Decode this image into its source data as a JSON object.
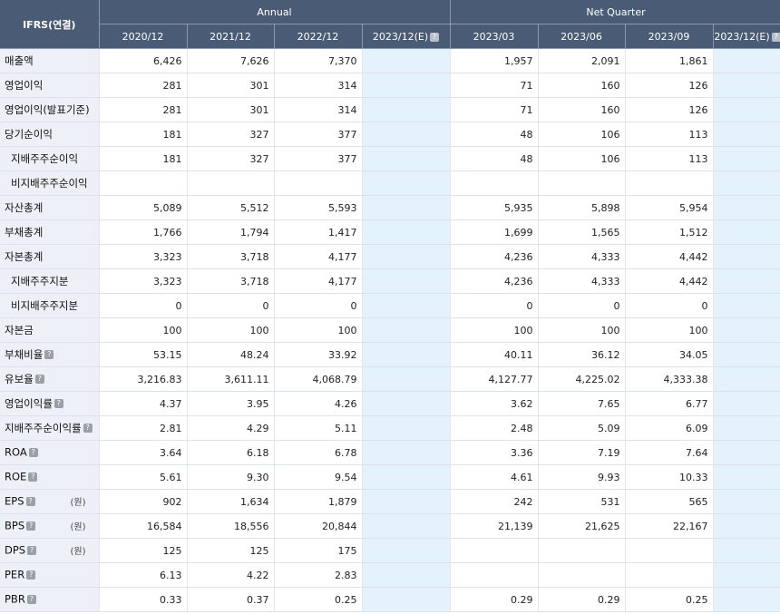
{
  "header": {
    "corner": "IFRS(연결)",
    "annual_label": "Annual",
    "quarter_label": "Net Quarter",
    "annual_periods": [
      "2020/12",
      "2021/12",
      "2022/12",
      "2023/12(E)"
    ],
    "quarter_periods": [
      "2023/03",
      "2023/06",
      "2023/09",
      "2023/12(E)"
    ],
    "help_icon": "question-mark-icon"
  },
  "rows": [
    {
      "label": "매출액",
      "indent": false,
      "help": false,
      "unit": "",
      "annual": [
        "6,426",
        "7,626",
        "7,370",
        ""
      ],
      "quarter": [
        "1,957",
        "2,091",
        "1,861",
        ""
      ]
    },
    {
      "label": "영업이익",
      "indent": false,
      "help": false,
      "unit": "",
      "annual": [
        "281",
        "301",
        "314",
        ""
      ],
      "quarter": [
        "71",
        "160",
        "126",
        ""
      ]
    },
    {
      "label": "영업이익(발표기준)",
      "indent": false,
      "help": false,
      "unit": "",
      "annual": [
        "281",
        "301",
        "314",
        ""
      ],
      "quarter": [
        "71",
        "160",
        "126",
        ""
      ]
    },
    {
      "label": "당기순이익",
      "indent": false,
      "help": false,
      "unit": "",
      "annual": [
        "181",
        "327",
        "377",
        ""
      ],
      "quarter": [
        "48",
        "106",
        "113",
        ""
      ]
    },
    {
      "label": "지배주주순이익",
      "indent": true,
      "help": false,
      "unit": "",
      "annual": [
        "181",
        "327",
        "377",
        ""
      ],
      "quarter": [
        "48",
        "106",
        "113",
        ""
      ]
    },
    {
      "label": "비지배주주순이익",
      "indent": true,
      "help": false,
      "unit": "",
      "annual": [
        "",
        "",
        "",
        ""
      ],
      "quarter": [
        "",
        "",
        "",
        ""
      ]
    },
    {
      "label": "자산총계",
      "indent": false,
      "help": false,
      "unit": "",
      "annual": [
        "5,089",
        "5,512",
        "5,593",
        ""
      ],
      "quarter": [
        "5,935",
        "5,898",
        "5,954",
        ""
      ]
    },
    {
      "label": "부채총계",
      "indent": false,
      "help": false,
      "unit": "",
      "annual": [
        "1,766",
        "1,794",
        "1,417",
        ""
      ],
      "quarter": [
        "1,699",
        "1,565",
        "1,512",
        ""
      ]
    },
    {
      "label": "자본총계",
      "indent": false,
      "help": false,
      "unit": "",
      "annual": [
        "3,323",
        "3,718",
        "4,177",
        ""
      ],
      "quarter": [
        "4,236",
        "4,333",
        "4,442",
        ""
      ]
    },
    {
      "label": "지배주주지분",
      "indent": true,
      "help": false,
      "unit": "",
      "annual": [
        "3,323",
        "3,718",
        "4,177",
        ""
      ],
      "quarter": [
        "4,236",
        "4,333",
        "4,442",
        ""
      ]
    },
    {
      "label": "비지배주주지분",
      "indent": true,
      "help": false,
      "unit": "",
      "annual": [
        "0",
        "0",
        "0",
        ""
      ],
      "quarter": [
        "0",
        "0",
        "0",
        ""
      ]
    },
    {
      "label": "자본금",
      "indent": false,
      "help": false,
      "unit": "",
      "annual": [
        "100",
        "100",
        "100",
        ""
      ],
      "quarter": [
        "100",
        "100",
        "100",
        ""
      ]
    },
    {
      "label": "부채비율",
      "indent": false,
      "help": true,
      "unit": "",
      "annual": [
        "53.15",
        "48.24",
        "33.92",
        ""
      ],
      "quarter": [
        "40.11",
        "36.12",
        "34.05",
        ""
      ]
    },
    {
      "label": "유보율",
      "indent": false,
      "help": true,
      "unit": "",
      "annual": [
        "3,216.83",
        "3,611.11",
        "4,068.79",
        ""
      ],
      "quarter": [
        "4,127.77",
        "4,225.02",
        "4,333.38",
        ""
      ]
    },
    {
      "label": "영업이익률",
      "indent": false,
      "help": true,
      "unit": "",
      "annual": [
        "4.37",
        "3.95",
        "4.26",
        ""
      ],
      "quarter": [
        "3.62",
        "7.65",
        "6.77",
        ""
      ]
    },
    {
      "label": "지배주주순이익률",
      "indent": false,
      "help": true,
      "unit": "",
      "annual": [
        "2.81",
        "4.29",
        "5.11",
        ""
      ],
      "quarter": [
        "2.48",
        "5.09",
        "6.09",
        ""
      ]
    },
    {
      "label": "ROA",
      "indent": false,
      "help": true,
      "unit": "",
      "annual": [
        "3.64",
        "6.18",
        "6.78",
        ""
      ],
      "quarter": [
        "3.36",
        "7.19",
        "7.64",
        ""
      ]
    },
    {
      "label": "ROE",
      "indent": false,
      "help": true,
      "unit": "",
      "annual": [
        "5.61",
        "9.30",
        "9.54",
        ""
      ],
      "quarter": [
        "4.61",
        "9.93",
        "10.33",
        ""
      ]
    },
    {
      "label": "EPS",
      "indent": false,
      "help": true,
      "unit": "(원)",
      "annual": [
        "902",
        "1,634",
        "1,879",
        ""
      ],
      "quarter": [
        "242",
        "531",
        "565",
        ""
      ]
    },
    {
      "label": "BPS",
      "indent": false,
      "help": true,
      "unit": "(원)",
      "annual": [
        "16,584",
        "18,556",
        "20,844",
        ""
      ],
      "quarter": [
        "21,139",
        "21,625",
        "22,167",
        ""
      ]
    },
    {
      "label": "DPS",
      "indent": false,
      "help": true,
      "unit": "(원)",
      "annual": [
        "125",
        "125",
        "175",
        ""
      ],
      "quarter": [
        "",
        "",
        "",
        ""
      ]
    },
    {
      "label": "PER",
      "indent": false,
      "help": true,
      "unit": "",
      "annual": [
        "6.13",
        "4.22",
        "2.83",
        ""
      ],
      "quarter": [
        "",
        "",
        "",
        ""
      ]
    },
    {
      "label": "PBR",
      "indent": false,
      "help": true,
      "unit": "",
      "annual": [
        "0.33",
        "0.37",
        "0.25",
        ""
      ],
      "quarter": [
        "0.29",
        "0.29",
        "0.25",
        ""
      ]
    }
  ]
}
